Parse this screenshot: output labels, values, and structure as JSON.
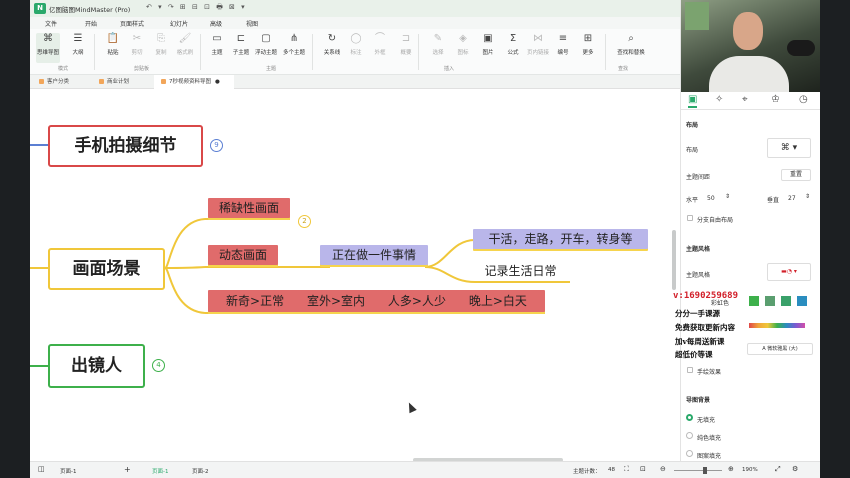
{
  "app": {
    "title": "亿图脑图MindMaster (Pro)",
    "logo": "N",
    "quick_actions": "↶ ▾ ↷  ⊞ ⊟ ⊡ 🖶 ⊠ ▾"
  },
  "menu": [
    "文件",
    "开始",
    "页面样式",
    "幻灯片",
    "高级",
    "视图"
  ],
  "menu_active": "开始",
  "ribbon": {
    "tools": [
      {
        "name": "mindmap-tool",
        "icon": "⌘",
        "label": "思维导图",
        "sel": true
      },
      {
        "name": "outline-tool",
        "icon": "☰",
        "label": "大纲"
      },
      {
        "name": "paste-tool",
        "icon": "📋",
        "label": "粘贴"
      },
      {
        "name": "cut-tool",
        "icon": "✂",
        "label": "剪切",
        "dim": true
      },
      {
        "name": "copy-tool",
        "icon": "⎘",
        "label": "复制",
        "dim": true
      },
      {
        "name": "format-painter-tool",
        "icon": "🖌",
        "label": "格式刷",
        "dim": true
      },
      {
        "name": "topic-tool",
        "icon": "▭",
        "label": "主题"
      },
      {
        "name": "subtopic-tool",
        "icon": "⊏",
        "label": "子主题"
      },
      {
        "name": "floating-topic-tool",
        "icon": "▢",
        "label": "浮动主题"
      },
      {
        "name": "multi-topic-tool",
        "icon": "⋔",
        "label": "多个主题"
      },
      {
        "name": "relation-tool",
        "icon": "↻",
        "label": "关系线"
      },
      {
        "name": "callout-tool",
        "icon": "◯",
        "label": "标注",
        "dim": true
      },
      {
        "name": "outer-frame-tool",
        "icon": "⌒",
        "label": "外框",
        "dim": true
      },
      {
        "name": "summary-tool",
        "icon": "⊐",
        "label": "概要",
        "dim": true
      },
      {
        "name": "select-tool",
        "icon": "✎",
        "label": "选择",
        "dim": true
      },
      {
        "name": "icon-tool",
        "icon": "◈",
        "label": "图标",
        "dim": true
      },
      {
        "name": "image-tool",
        "icon": "▣",
        "label": "图片"
      },
      {
        "name": "formula-tool",
        "icon": "Σ",
        "label": "公式"
      },
      {
        "name": "cross-link-tool",
        "icon": "⋈",
        "label": "页内链接",
        "dim": true
      },
      {
        "name": "numbering-tool",
        "icon": "≡",
        "label": "编号"
      },
      {
        "name": "more-tool",
        "icon": "⊞",
        "label": "更多"
      },
      {
        "name": "find-replace-tool",
        "icon": "⌕",
        "label": "查找和替换"
      }
    ],
    "groups": [
      "模式",
      "剪贴板",
      "主题",
      "插入",
      "查找"
    ]
  },
  "doc_tabs": [
    {
      "label": "客户分类",
      "active": false
    },
    {
      "label": "商业计划",
      "active": false
    },
    {
      "label": "7秒视频资料导图",
      "active": true
    }
  ],
  "mindmap": {
    "topics": [
      {
        "label": "手机拍摄细节",
        "badge": "9",
        "color": "#d94848"
      },
      {
        "label": "画面场景",
        "color": "#f0c73a"
      },
      {
        "label": "出镜人",
        "badge": "4",
        "color": "#3db04b"
      }
    ],
    "subtopics": {
      "scarcity": {
        "label": "稀缺性画面",
        "badge": "2"
      },
      "dynamic": {
        "label": "动态画面"
      },
      "doing": {
        "label": "正在做一件事情"
      },
      "work": {
        "label": "干活，走路，开车，转身等"
      },
      "record": {
        "label": "记录生活日常"
      },
      "compare": {
        "label": "新奇>正常      室外>室内      人多>人少      晚上>白天"
      }
    }
  },
  "right_panel": {
    "tabs": [
      "layout-tab",
      "style-tab",
      "map-tab",
      "theme-tab",
      "history-tab"
    ],
    "layout_section": "布局",
    "layout_label": "布局",
    "spacing_label": "主题间距",
    "reset_label": "重置",
    "horizontal_label": "水平",
    "horizontal_value": "50",
    "vertical_label": "垂直",
    "vertical_value": "27",
    "free_layout_label": "分支自由布局",
    "theme_section": "主题风格",
    "theme_label": "主题风格",
    "color_label": "彩虹色",
    "font_label": "手绘效果",
    "font_value": "A 微软雅黑 (大)",
    "background_section": "导图背景",
    "bg_options": [
      "无填充",
      "纯色填充",
      "图案填充"
    ]
  },
  "overlay_text": {
    "wechat": "v:1690259689",
    "lines": [
      "分分一手课源",
      "免费获取更新内容",
      "加v每周送新课",
      "超低价等课"
    ]
  },
  "status": {
    "page_label": "页面-1",
    "tabs": [
      "页面-1",
      "页面-2"
    ],
    "topic_count_label": "主题计数：",
    "topic_count": "48",
    "zoom": "190%"
  },
  "colors": {
    "accent": "#2aa96b",
    "red_topic": "#d94848",
    "yellow_topic": "#f0c73a",
    "green_topic": "#3db04b",
    "red_sub": "#e06b6b",
    "lavender_sub": "#b9b6ea"
  }
}
